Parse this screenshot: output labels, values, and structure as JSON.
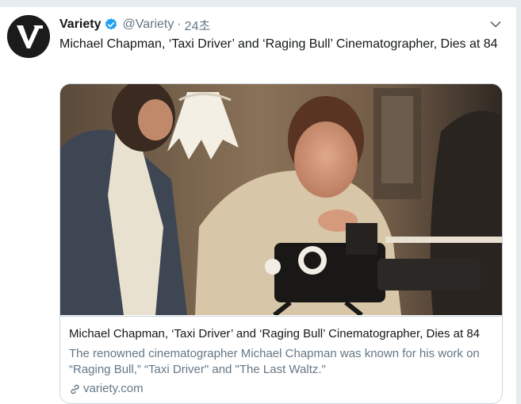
{
  "tweet": {
    "author_name": "Variety",
    "handle": "@Variety",
    "separator": "·",
    "time": "24초",
    "text": "Michael Chapman, ‘Taxi Driver’ and ‘Raging Bull’ Cinematographer, Dies at 84"
  },
  "card": {
    "title": "Michael Chapman, ‘Taxi Driver’ and ‘Raging Bull’ Cinematographer, Dies at 84",
    "description": "The renowned cinematographer Michael Chapman was known for his work on “Raging Bull,” “Taxi Driver\" and \"The Last Waltz.\"",
    "domain": "variety.com"
  },
  "icons": {
    "avatar": "variety-logo",
    "verified": "verified-badge-icon",
    "menu": "chevron-down-icon",
    "link": "link-icon"
  },
  "colors": {
    "verified_blue": "#1da1f2",
    "secondary_text": "#657786",
    "border": "#ccd6dd"
  }
}
